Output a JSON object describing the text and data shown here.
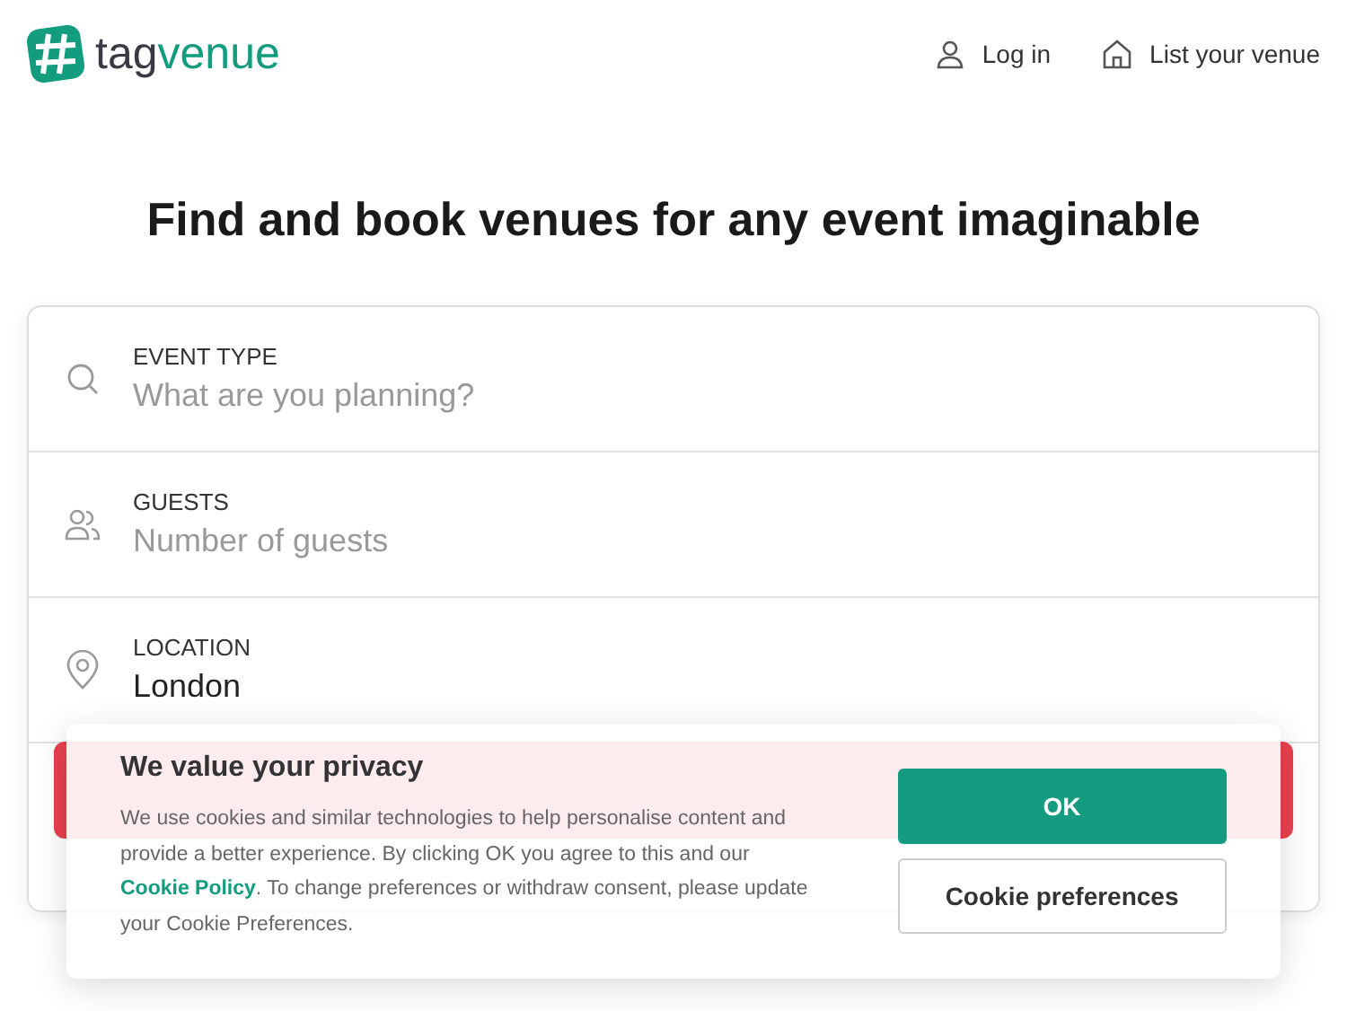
{
  "header": {
    "logo_text": [
      "tag",
      "venue"
    ],
    "nav": [
      {
        "kind": "user",
        "label": "Log in"
      },
      {
        "kind": "home",
        "label": "List your venue"
      }
    ]
  },
  "headline": "Find and book venues for any event imaginable",
  "search_form": {
    "fields": [
      {
        "kind": "search",
        "label": "EVENT TYPE",
        "placeholder": "What are you planning?"
      },
      {
        "kind": "guests",
        "label": "GUESTS",
        "placeholder": "Number of guests"
      },
      {
        "kind": "location",
        "label": "LOCATION",
        "value": "London"
      }
    ]
  },
  "cookie_banner": {
    "title": "We value your privacy",
    "text_before": "We use cookies and similar technologies to help personalise content and provide a better experience. By clicking OK you agree to this and our ",
    "link": "Cookie Policy",
    "text_after": ". To change preferences or withdraw consent, please update your Cookie Preferences.",
    "buttons": [
      {
        "kind": "primary",
        "label": "OK"
      },
      {
        "kind": "secondary",
        "label": "Cookie preferences"
      }
    ]
  }
}
